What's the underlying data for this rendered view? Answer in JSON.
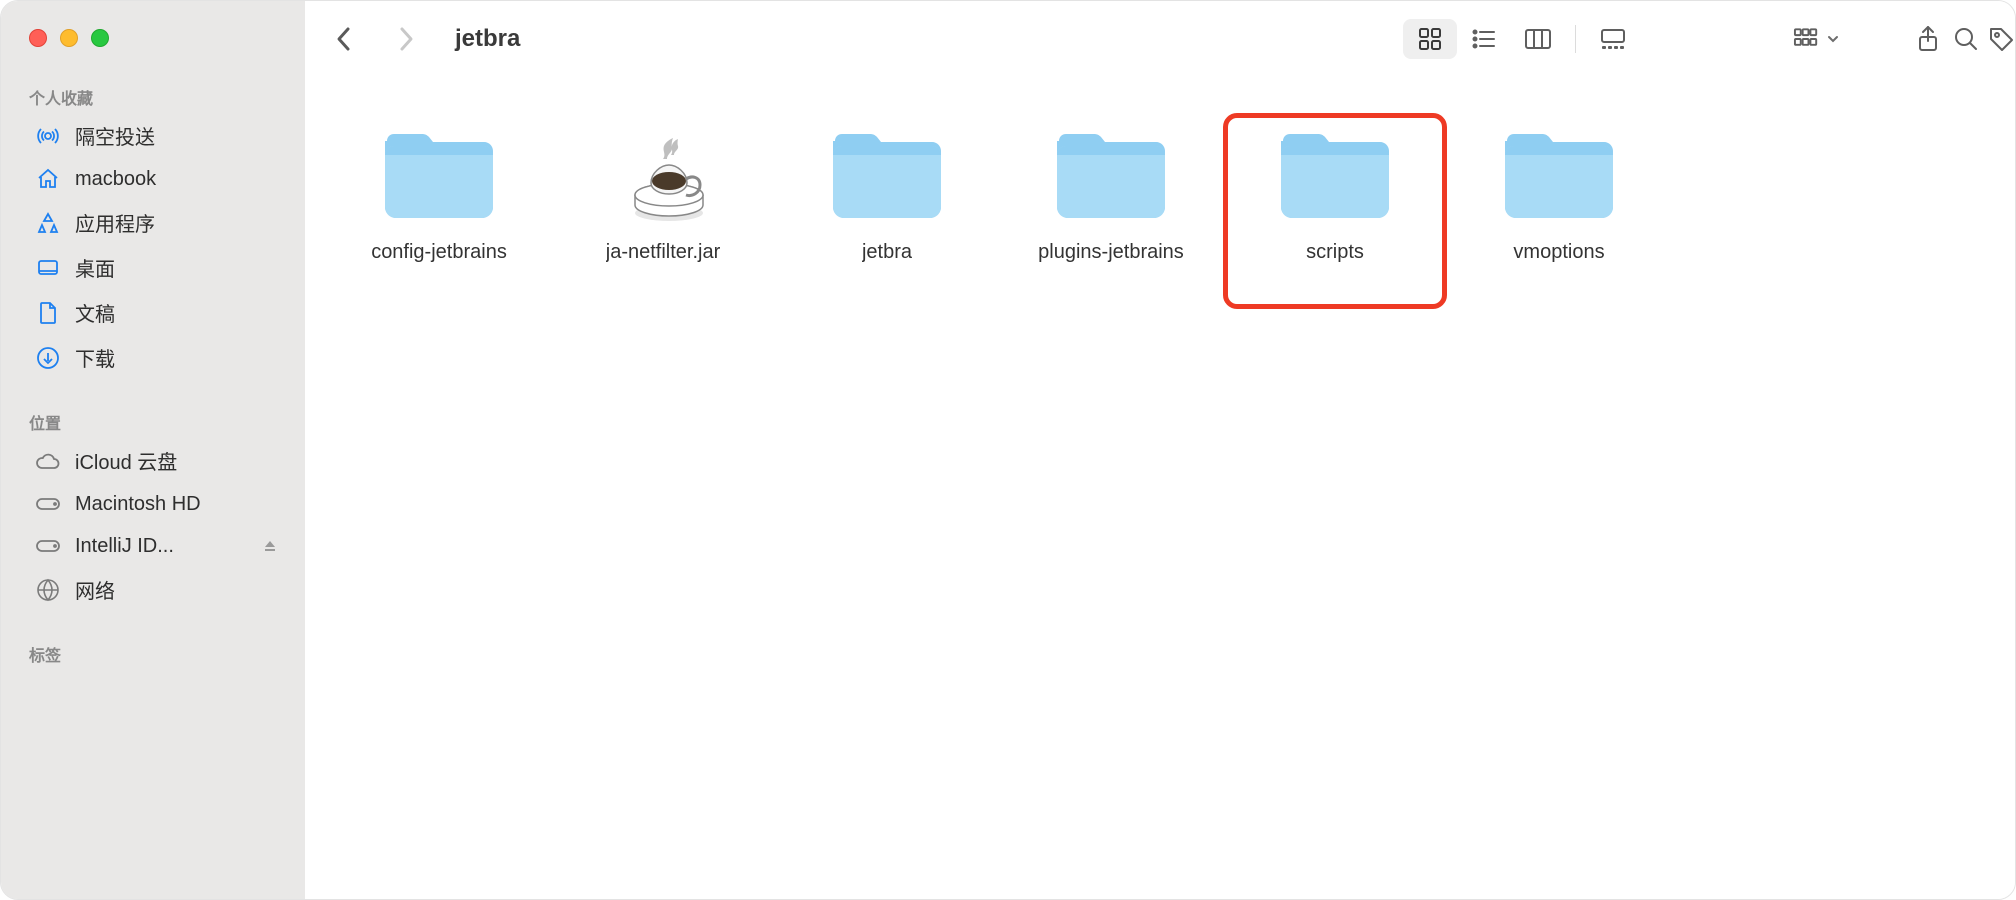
{
  "window": {
    "title": "jetbra"
  },
  "sidebar": {
    "sections": [
      {
        "header": "个人收藏",
        "items": [
          {
            "icon": "airdrop",
            "label": "隔空投送"
          },
          {
            "icon": "home",
            "label": "macbook"
          },
          {
            "icon": "apps",
            "label": "应用程序"
          },
          {
            "icon": "desktop",
            "label": "桌面"
          },
          {
            "icon": "doc",
            "label": "文稿"
          },
          {
            "icon": "download",
            "label": "下载"
          }
        ]
      },
      {
        "header": "位置",
        "items": [
          {
            "icon": "cloud",
            "label": "iCloud 云盘"
          },
          {
            "icon": "disk",
            "label": "Macintosh HD"
          },
          {
            "icon": "disk",
            "label": "IntelliJ ID...",
            "eject": true
          },
          {
            "icon": "globe",
            "label": "网络"
          }
        ]
      },
      {
        "header": "标签",
        "items": []
      }
    ]
  },
  "files": [
    {
      "name": "config-jetbrains",
      "type": "folder"
    },
    {
      "name": "ja-netfilter.jar",
      "type": "jar"
    },
    {
      "name": "jetbra",
      "type": "folder"
    },
    {
      "name": "plugins-jetbrains",
      "type": "folder"
    },
    {
      "name": "scripts",
      "type": "folder",
      "highlighted": true
    },
    {
      "name": "vmoptions",
      "type": "folder"
    }
  ]
}
